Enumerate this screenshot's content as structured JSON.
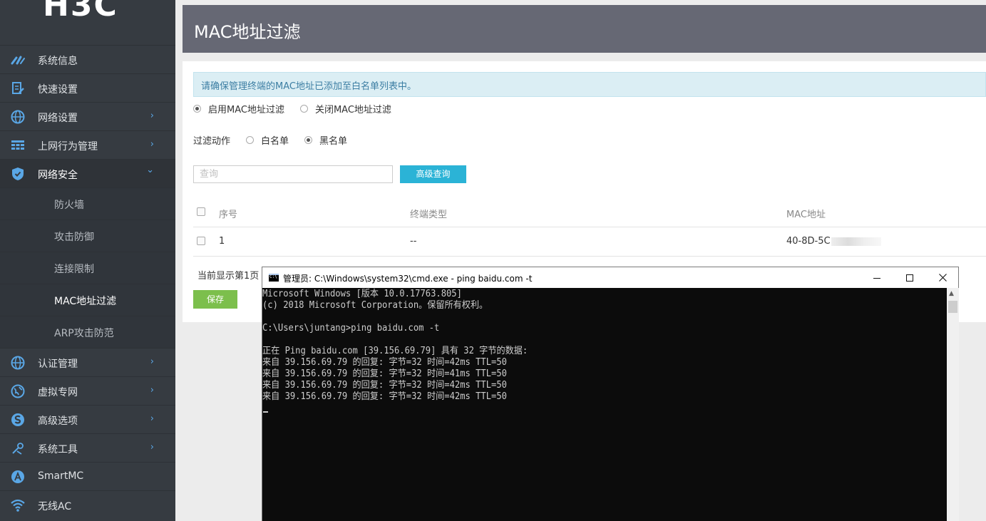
{
  "brand": {
    "logo_text": "H3C"
  },
  "sidebar": {
    "items": [
      {
        "label": "系统信息",
        "icon": "dashboard-icon"
      },
      {
        "label": "快速设置",
        "icon": "quick-setup-icon"
      },
      {
        "label": "网络设置",
        "icon": "globe-icon",
        "chevron": "›"
      },
      {
        "label": "上网行为管理",
        "icon": "behavior-grid-icon",
        "chevron": "›"
      },
      {
        "label": "网络安全",
        "icon": "shield-icon",
        "chevron": "⌄"
      },
      {
        "label": "认证管理",
        "icon": "globe-icon",
        "chevron": "›"
      },
      {
        "label": "虚拟专网",
        "icon": "vpn-globe-icon",
        "chevron": "›"
      },
      {
        "label": "高级选项",
        "icon": "advanced-icon",
        "chevron": "›"
      },
      {
        "label": "系统工具",
        "icon": "tools-icon",
        "chevron": "›"
      },
      {
        "label": "SmartMC",
        "icon": "smartmc-icon"
      },
      {
        "label": "无线AC",
        "icon": "wifi-icon"
      }
    ],
    "security_subitems": [
      {
        "label": "防火墙"
      },
      {
        "label": "攻击防御"
      },
      {
        "label": "连接限制"
      },
      {
        "label": "MAC地址过滤"
      },
      {
        "label": "ARP攻击防范"
      }
    ]
  },
  "page": {
    "title": "MAC地址过滤",
    "notice": "请确保管理终端的MAC地址已添加至白名单列表中。",
    "filter_mode": {
      "enable_label": "启用MAC地址过滤",
      "disable_label": "关闭MAC地址过滤",
      "selected": "enable"
    },
    "filter_action": {
      "label": "过滤动作",
      "whitelist_label": "白名单",
      "blacklist_label": "黑名单",
      "selected": "blacklist"
    },
    "search": {
      "placeholder": "查询",
      "advanced_button": "高级查询"
    },
    "table": {
      "headers": [
        "序号",
        "终端类型",
        "MAC地址"
      ],
      "rows": [
        {
          "index": "1",
          "type": "--",
          "mac": "40-8D-5C"
        }
      ]
    },
    "footer_text": "当前显示第1页",
    "save_button": "保存"
  },
  "cmd": {
    "title": "管理员: C:\\Windows\\system32\\cmd.exe - ping  baidu.com -t",
    "lines": [
      "Microsoft Windows [版本 10.0.17763.805]",
      "(c) 2018 Microsoft Corporation。保留所有权利。",
      "",
      "C:\\Users\\juntang>ping baidu.com -t",
      "",
      "正在 Ping baidu.com [39.156.69.79] 具有 32 字节的数据:",
      "来自 39.156.69.79 的回复: 字节=32 时间=42ms TTL=50",
      "来自 39.156.69.79 的回复: 字节=32 时间=41ms TTL=50",
      "来自 39.156.69.79 的回复: 字节=32 时间=42ms TTL=50",
      "来自 39.156.69.79 的回复: 字节=32 时间=42ms TTL=50"
    ]
  },
  "colors": {
    "sidebar_bg": "#363b41",
    "header_bg": "#666874",
    "accent_blue": "#2bb3d6",
    "save_green": "#7cbf4c",
    "icon_blue": "#5aa7e6"
  }
}
